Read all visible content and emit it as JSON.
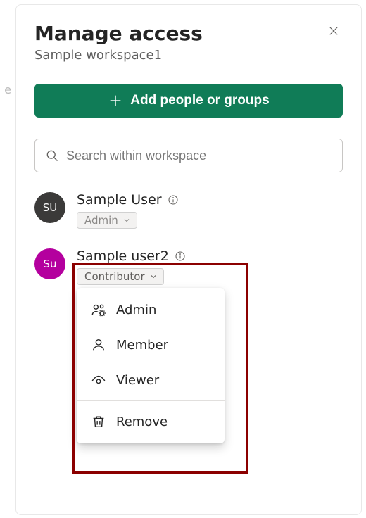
{
  "header": {
    "title": "Manage access",
    "subtitle": "Sample workspace1"
  },
  "actions": {
    "add_label": "Add people or groups"
  },
  "search": {
    "placeholder": "Search within workspace"
  },
  "users": [
    {
      "initials": "SU",
      "name": "Sample User",
      "role_label": "Admin",
      "editable": false
    },
    {
      "initials": "Su",
      "name": "Sample user2",
      "role_label": "Contributor",
      "editable": true
    }
  ],
  "role_menu": {
    "items": [
      {
        "icon": "people-settings-icon",
        "label": "Admin"
      },
      {
        "icon": "person-icon",
        "label": "Member"
      },
      {
        "icon": "eye-icon",
        "label": "Viewer"
      }
    ],
    "remove_label": "Remove"
  },
  "edge_hint": "e"
}
